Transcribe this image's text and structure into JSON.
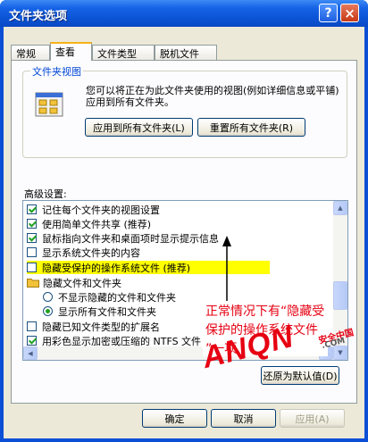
{
  "window": {
    "title": "文件夹选项",
    "help_label": "?",
    "close_label": "×"
  },
  "tabs": [
    {
      "label": "常规",
      "active": false
    },
    {
      "label": "查看",
      "active": true
    },
    {
      "label": "文件类型",
      "active": false
    },
    {
      "label": "脱机文件",
      "active": false
    }
  ],
  "folder_views": {
    "legend": "文件夹视图",
    "description": "您可以将正在为此文件夹使用的视图(例如详细信息或平铺)应用到所有文件夹。",
    "apply_all_label": "应用到所有文件夹(L)",
    "reset_all_label": "重置所有文件夹(R)"
  },
  "advanced": {
    "label": "高级设置:",
    "items": [
      {
        "type": "checkbox",
        "checked": true,
        "label": "记住每个文件夹的视图设置"
      },
      {
        "type": "checkbox",
        "checked": true,
        "label": "使用简单文件共享 (推荐)"
      },
      {
        "type": "checkbox",
        "checked": true,
        "label": "鼠标指向文件夹和桌面项时显示提示信息"
      },
      {
        "type": "checkbox",
        "checked": false,
        "label": "显示系统文件夹的内容"
      },
      {
        "type": "checkbox",
        "checked": false,
        "label": "隐藏受保护的操作系统文件 (推荐)",
        "highlight": true
      },
      {
        "type": "folder",
        "label": "隐藏文件和文件夹"
      },
      {
        "type": "radio",
        "checked": false,
        "label": "不显示隐藏的文件和文件夹"
      },
      {
        "type": "radio",
        "checked": true,
        "label": "显示所有文件和文件夹"
      },
      {
        "type": "checkbox",
        "checked": false,
        "label": "隐藏已知文件类型的扩展名"
      },
      {
        "type": "checkbox",
        "checked": true,
        "label": "用彩色显示加密或压缩的 NTFS 文件"
      }
    ],
    "restore_defaults_label": "还原为默认值(D)"
  },
  "dialog_buttons": {
    "ok_label": "确定",
    "cancel_label": "取消",
    "apply_label": "应用(A)"
  },
  "annotation": {
    "text": "正常情况下有“隐藏受保护的操作系统文件 ”一项"
  },
  "watermark": {
    "main": "ANQN",
    "cn": "安全中国",
    "domain": ".COM"
  },
  "colors": {
    "title_bar": "#0a4fd6",
    "highlight": "#ffff00",
    "annotation_text": "#e60012"
  }
}
